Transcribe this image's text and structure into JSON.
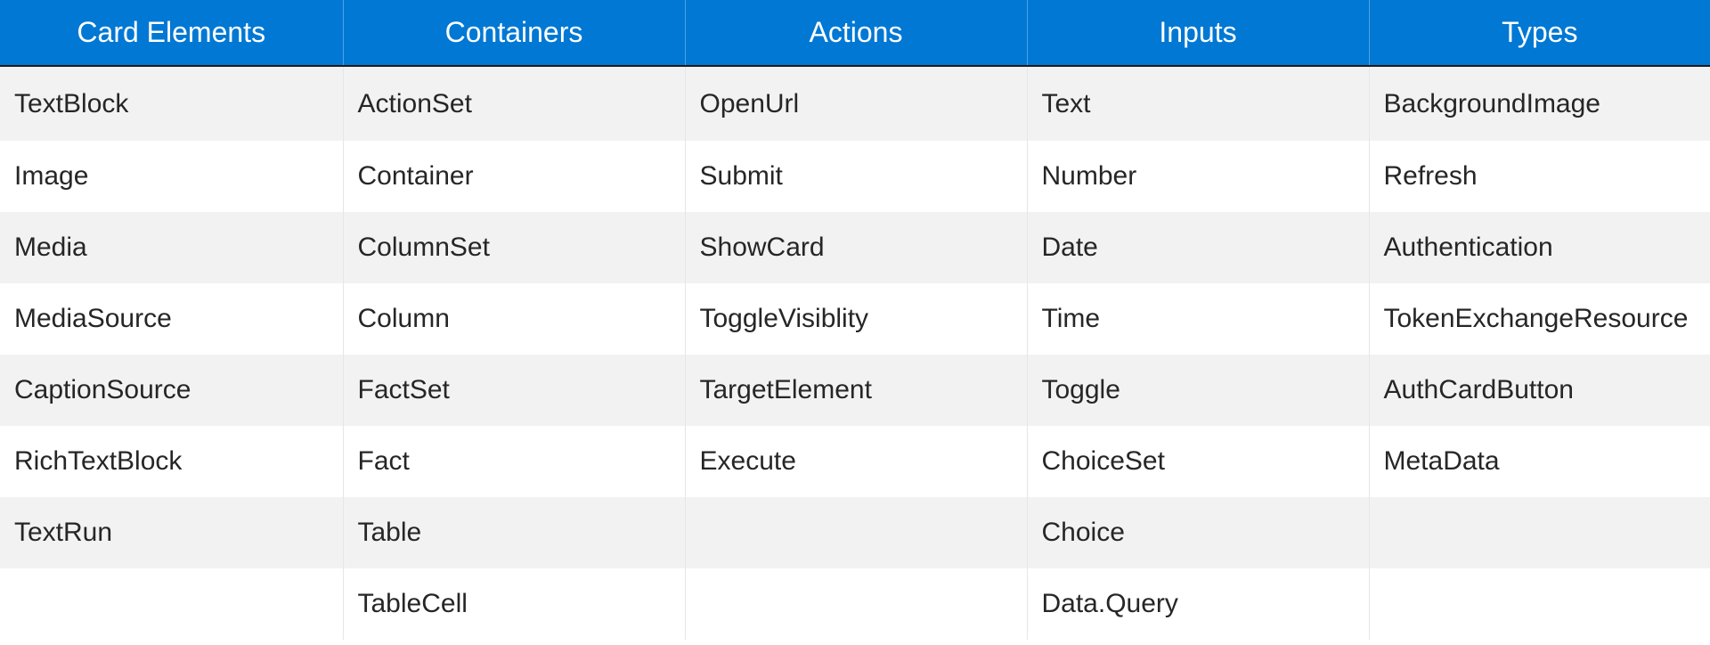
{
  "table": {
    "headers": [
      "Card Elements",
      "Containers",
      "Actions",
      "Inputs",
      "Types"
    ],
    "rows": [
      [
        "TextBlock",
        "ActionSet",
        "OpenUrl",
        "Text",
        "BackgroundImage"
      ],
      [
        "Image",
        "Container",
        "Submit",
        "Number",
        "Refresh"
      ],
      [
        "Media",
        "ColumnSet",
        "ShowCard",
        "Date",
        "Authentication"
      ],
      [
        "MediaSource",
        "Column",
        "ToggleVisiblity",
        "Time",
        "TokenExchangeResource"
      ],
      [
        "CaptionSource",
        "FactSet",
        "TargetElement",
        "Toggle",
        "AuthCardButton"
      ],
      [
        "RichTextBlock",
        "Fact",
        "Execute",
        "ChoiceSet",
        "MetaData"
      ],
      [
        "TextRun",
        "Table",
        "",
        "Choice",
        ""
      ],
      [
        "",
        "TableCell",
        "",
        "Data.Query",
        ""
      ]
    ]
  },
  "colors": {
    "header_background": "#0078d4",
    "header_text": "#ffffff",
    "row_alt_background": "#f2f2f2",
    "row_background": "#ffffff",
    "cell_text": "#262626"
  }
}
